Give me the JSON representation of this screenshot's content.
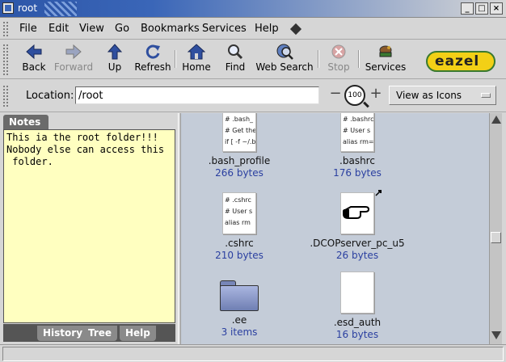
{
  "window": {
    "title": "root"
  },
  "menubar": {
    "items": [
      "File",
      "Edit",
      "View",
      "Go",
      "Bookmarks",
      "Services",
      "Help"
    ]
  },
  "toolbar": {
    "back": "Back",
    "forward": "Forward",
    "up": "Up",
    "refresh": "Refresh",
    "home": "Home",
    "find": "Find",
    "web_search": "Web Search",
    "stop": "Stop",
    "services": "Services"
  },
  "brand": {
    "logo_text": "eazel"
  },
  "location": {
    "label": "Location:",
    "value": "/root",
    "zoom": "100",
    "view_as": "View as Icons"
  },
  "sidebar": {
    "notes_tab": "Notes",
    "notes_text": "This ia the root folder!!!\nNobody else can access this\n folder.",
    "tabs": [
      "History",
      "Tree",
      "Help"
    ]
  },
  "files": [
    {
      "name": ".bash_profile",
      "size": "266 bytes",
      "preview": [
        "# .bash_",
        "# Get the",
        "if [ -f ~/.b"
      ]
    },
    {
      "name": ".bashrc",
      "size": "176 bytes",
      "preview": [
        "# .bashrc",
        "# User s",
        "alias rm="
      ]
    },
    {
      "name": ".cshrc",
      "size": "210 bytes",
      "preview": [
        "# .cshrc",
        "# User s",
        "alias rm"
      ]
    },
    {
      "name": ".DCOPserver_pc_u5",
      "size": "26 bytes"
    },
    {
      "name": ".ee",
      "size": "3 items"
    },
    {
      "name": ".esd_auth",
      "size": "16 bytes"
    }
  ],
  "colors": {
    "content_bg": "#c4ccd8",
    "notes_bg": "#ffffc0",
    "size_text": "#2a3fa0",
    "title_bar": "#2d56a8"
  }
}
